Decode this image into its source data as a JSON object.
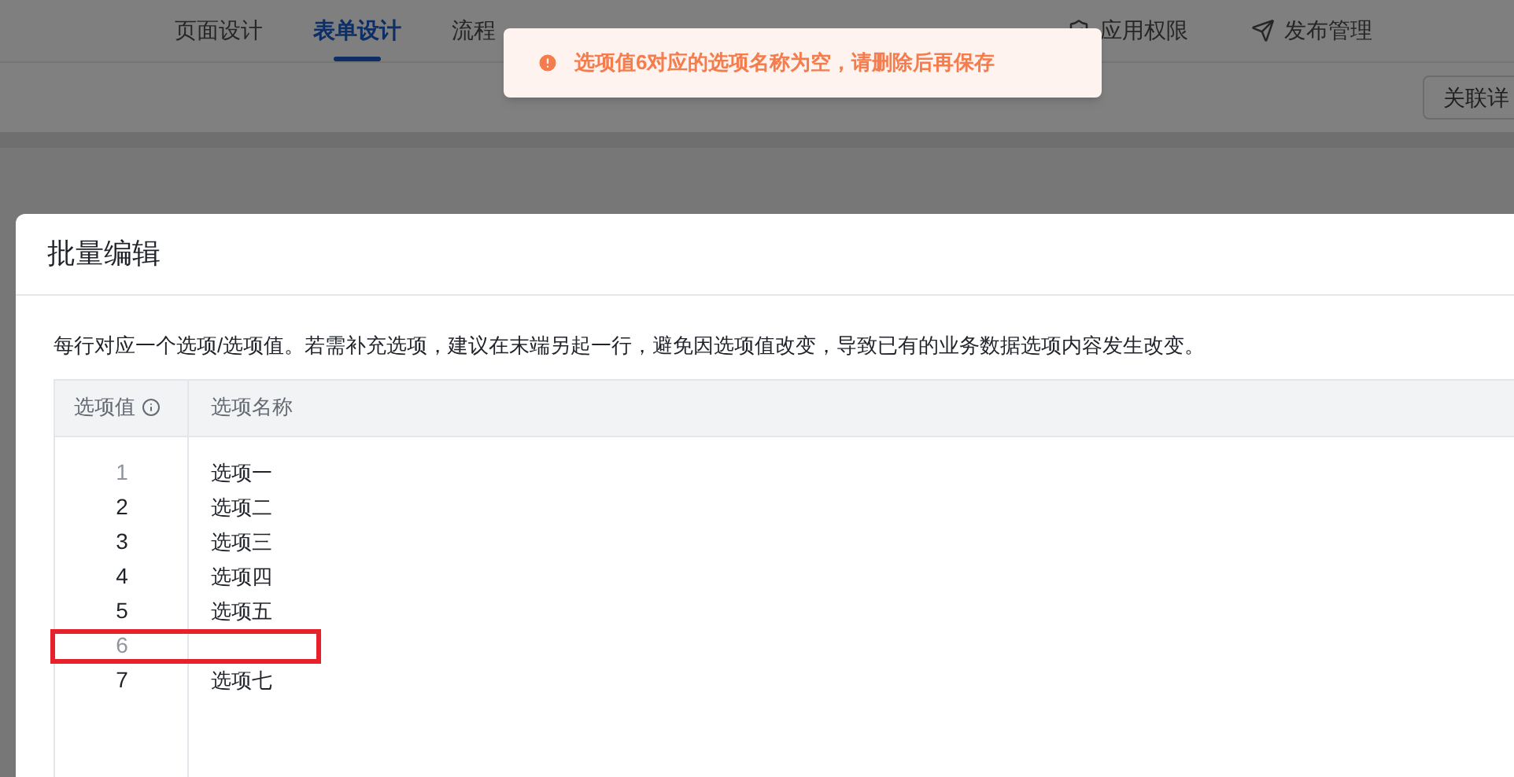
{
  "nav_tabs": [
    {
      "label": "页面设计",
      "selected": false,
      "kind": "plain"
    },
    {
      "label": "表单设计",
      "selected": true,
      "kind": "plain"
    },
    {
      "label": "流程",
      "selected": false,
      "kind": "plain"
    },
    {
      "label": "应用权限",
      "selected": false,
      "kind": "shield"
    },
    {
      "label": "发布管理",
      "selected": false,
      "kind": "send"
    }
  ],
  "toolbar": {
    "button": "关联详"
  },
  "toast": {
    "message": "选项值6对应的选项名称为空，请删除后再保存"
  },
  "dialog": {
    "title": "批量编辑",
    "description": "每行对应一个选项/选项值。若需补充选项，建议在末端另起一行，避免因选项值改变，导致已有的业务数据选项内容发生改变。",
    "table": {
      "columns": [
        "选项值",
        "选项名称"
      ],
      "rows": [
        {
          "value": "1",
          "name": "选项一",
          "muted": true,
          "highlighted": false
        },
        {
          "value": "2",
          "name": "选项二",
          "muted": false,
          "highlighted": false
        },
        {
          "value": "3",
          "name": "选项三",
          "muted": false,
          "highlighted": false
        },
        {
          "value": "4",
          "name": "选项四",
          "muted": false,
          "highlighted": false
        },
        {
          "value": "5",
          "name": "选项五",
          "muted": false,
          "highlighted": false
        },
        {
          "value": "6",
          "muted": true,
          "highlighted": true
        },
        {
          "value": "7",
          "name": "选项七",
          "muted": false,
          "highlighted": false
        }
      ]
    }
  }
}
